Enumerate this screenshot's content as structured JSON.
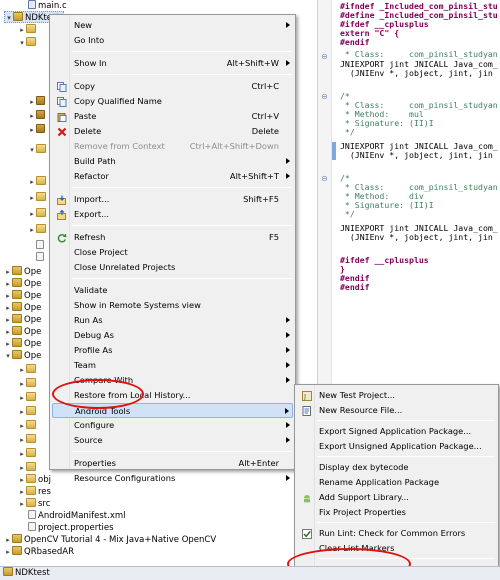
{
  "explorer": {
    "top_file": "main.c",
    "project": "NDKtest",
    "collapsed_projects": [
      "Ope",
      "Ope",
      "Ope",
      "Ope",
      "Ope",
      "Ope",
      "Ope",
      "Ope"
    ],
    "open_project": "Ope",
    "tail_items": [
      "obj",
      "res",
      "src",
      "AndroidManifest.xml",
      "project.properties"
    ],
    "bottom_projects": [
      "OpenCV Tutorial 4 - Mix Java+Native OpenCV",
      "QRbasedAR"
    ]
  },
  "status_bar": {
    "text": "NDKtest"
  },
  "editor": {
    "lines": [
      "#ifndef _Included_com_pinsil_stu",
      "#define _Included_com_pinsil_stu",
      "#ifdef __cplusplus",
      "extern \"C\" {",
      "#endif",
      " * Class:     com_pinsil_studyan",
      "JNIEXPORT jint JNICALL Java_com_",
      "  (JNIEnv *, jobject, jint, jin",
      "",
      "/*",
      " * Class:     com_pinsil_studyan",
      " * Method:    mul",
      " * Signature: (II)I",
      " */",
      "JNIEXPORT jint JNICALL Java_com_",
      "  (JNIEnv *, jobject, jint, jin",
      "",
      "/*",
      " * Class:     com_pinsil_studyan",
      " * Method:    div",
      " * Signature: (II)I",
      " */",
      "JNIEXPORT jint JNICALL Java_com_",
      "  (JNIEnv *, jobject, jint, jin",
      "",
      "#ifdef __cplusplus",
      "}",
      "#endif",
      "#endif"
    ]
  },
  "context_menu": {
    "items": [
      {
        "label": "New",
        "submenu": true
      },
      {
        "label": "Go Into"
      },
      {
        "sep": true
      },
      {
        "label": "Show In",
        "shortcut": "Alt+Shift+W",
        "submenu": true
      },
      {
        "sep": true
      },
      {
        "label": "Copy",
        "shortcut": "Ctrl+C",
        "icon": "copy-icon"
      },
      {
        "label": "Copy Qualified Name",
        "icon": "copy-icon"
      },
      {
        "label": "Paste",
        "shortcut": "Ctrl+V",
        "icon": "paste-icon"
      },
      {
        "label": "Delete",
        "shortcut": "Delete",
        "icon": "delete-icon"
      },
      {
        "label": "Remove from Context",
        "shortcut": "Ctrl+Alt+Shift+Down",
        "disabled": true
      },
      {
        "label": "Build Path",
        "submenu": true
      },
      {
        "label": "Refactor",
        "shortcut": "Alt+Shift+T",
        "submenu": true
      },
      {
        "sep": true
      },
      {
        "label": "Import...",
        "shortcut": "Shift+F5",
        "icon": "import-icon"
      },
      {
        "label": "Export...",
        "icon": "export-icon"
      },
      {
        "sep": true
      },
      {
        "label": "Refresh",
        "shortcut": "F5",
        "icon": "refresh-icon"
      },
      {
        "label": "Close Project"
      },
      {
        "label": "Close Unrelated Projects"
      },
      {
        "sep": true
      },
      {
        "label": "Validate"
      },
      {
        "label": "Show in Remote Systems view"
      },
      {
        "label": "Run As",
        "submenu": true
      },
      {
        "label": "Debug As",
        "submenu": true
      },
      {
        "label": "Profile As",
        "submenu": true
      },
      {
        "label": "Team",
        "submenu": true
      },
      {
        "label": "Compare With",
        "submenu": true
      },
      {
        "label": "Restore from Local History..."
      },
      {
        "label": "Android Tools",
        "submenu": true,
        "hot": true
      },
      {
        "label": "Configure",
        "submenu": true
      },
      {
        "label": "Source",
        "submenu": true
      },
      {
        "sep": true
      },
      {
        "label": "Properties",
        "shortcut": "Alt+Enter"
      },
      {
        "label": "Resource Configurations",
        "submenu": true
      }
    ]
  },
  "submenu": {
    "items": [
      {
        "label": "New Test Project...",
        "icon": "test-project-icon"
      },
      {
        "label": "New Resource File...",
        "icon": "resource-file-icon"
      },
      {
        "sep": true
      },
      {
        "label": "Export Signed Application Package..."
      },
      {
        "label": "Export Unsigned Application Package..."
      },
      {
        "sep": true
      },
      {
        "label": "Display dex bytecode"
      },
      {
        "label": "Rename Application Package"
      },
      {
        "label": "Add Support Library...",
        "icon": "android-icon"
      },
      {
        "label": "Fix Project Properties"
      },
      {
        "sep": true
      },
      {
        "label": "Run Lint: Check for Common Errors",
        "icon": "lint-check-icon"
      },
      {
        "label": "Clear Lint Markers"
      },
      {
        "sep": true
      },
      {
        "label": "Add Native Support..."
      }
    ]
  },
  "colors": {
    "annotation_ring": "#e01010",
    "menu_hover": "#cfe2f8",
    "selection": "#d6e4f5"
  }
}
